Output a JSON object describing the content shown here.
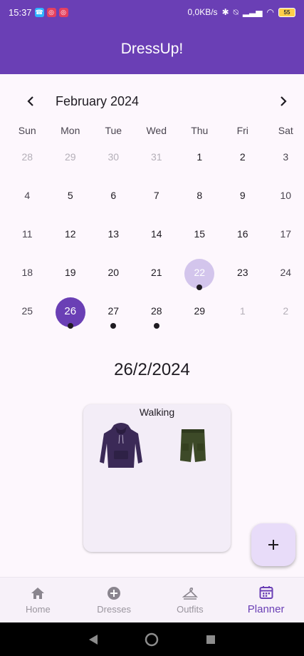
{
  "status_bar": {
    "time": "15:37",
    "net_speed": "0,0KB/s",
    "battery": "55"
  },
  "app_bar": {
    "title": "DressUp!"
  },
  "calendar": {
    "month_label": "February 2024",
    "weekdays": [
      "Sun",
      "Mon",
      "Tue",
      "Wed",
      "Thu",
      "Fri",
      "Sat"
    ],
    "weeks": [
      [
        {
          "d": "28",
          "muted": true
        },
        {
          "d": "29",
          "muted": true
        },
        {
          "d": "30",
          "muted": true
        },
        {
          "d": "31",
          "muted": true
        },
        {
          "d": "1"
        },
        {
          "d": "2"
        },
        {
          "d": "3",
          "weekend": true
        }
      ],
      [
        {
          "d": "4",
          "weekend": true
        },
        {
          "d": "5"
        },
        {
          "d": "6"
        },
        {
          "d": "7"
        },
        {
          "d": "8"
        },
        {
          "d": "9"
        },
        {
          "d": "10",
          "weekend": true
        }
      ],
      [
        {
          "d": "11",
          "weekend": true
        },
        {
          "d": "12"
        },
        {
          "d": "13"
        },
        {
          "d": "14"
        },
        {
          "d": "15"
        },
        {
          "d": "16"
        },
        {
          "d": "17",
          "weekend": true
        }
      ],
      [
        {
          "d": "18",
          "weekend": true
        },
        {
          "d": "19"
        },
        {
          "d": "20"
        },
        {
          "d": "21"
        },
        {
          "d": "22",
          "today": true,
          "event": true
        },
        {
          "d": "23"
        },
        {
          "d": "24",
          "weekend": true
        }
      ],
      [
        {
          "d": "25",
          "weekend": true
        },
        {
          "d": "26",
          "selected": true,
          "event": true
        },
        {
          "d": "27",
          "event": true
        },
        {
          "d": "28",
          "event": true
        },
        {
          "d": "29"
        },
        {
          "d": "1",
          "muted": true
        },
        {
          "d": "2",
          "muted": true
        }
      ]
    ]
  },
  "selected_date": "26/2/2024",
  "outfit": {
    "title": "Walking",
    "items": [
      "hoodie",
      "shorts"
    ]
  },
  "fab": {
    "icon": "plus-icon"
  },
  "bottom_nav": {
    "items": [
      {
        "label": "Home",
        "icon": "home-icon"
      },
      {
        "label": "Dresses",
        "icon": "add-circle-icon"
      },
      {
        "label": "Outfits",
        "icon": "hanger-icon"
      },
      {
        "label": "Planner",
        "icon": "calendar-icon",
        "active": true
      }
    ]
  },
  "colors": {
    "primary": "#6a3fb5",
    "today_circle": "#d3c5ec",
    "fab_bg": "#e8dcf9",
    "card_bg": "#f3edf7"
  }
}
